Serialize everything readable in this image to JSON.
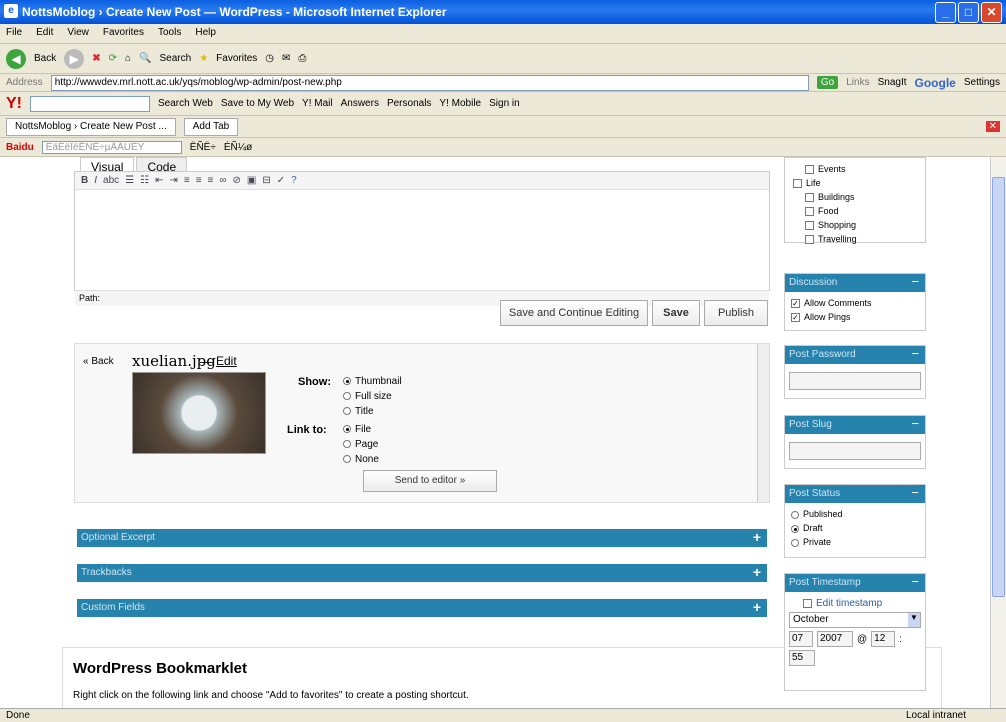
{
  "window": {
    "title": "NottsMoblog › Create New Post — WordPress - Microsoft Internet Explorer"
  },
  "menu": [
    "File",
    "Edit",
    "View",
    "Favorites",
    "Tools",
    "Help"
  ],
  "toolbar": {
    "back": "Back",
    "search": "Search",
    "favorites": "Favorites"
  },
  "address": {
    "label": "Address",
    "url": "http://wwwdev.mrl.nott.ac.uk/yqs/moblog/wp-admin/post-new.php",
    "go": "Go",
    "links": "Links",
    "snagit": "SnagIt",
    "google": "Google",
    "settings": "Settings"
  },
  "yahoo": {
    "search": "Search Web",
    "save": "Save to My Web",
    "mail": "Y! Mail",
    "answers": "Answers",
    "personals": "Personals",
    "mobile": "Y! Mobile",
    "signin": "Sign in"
  },
  "tabs": {
    "current": "NottsMoblog › Create New Post ...",
    "add": "Add Tab"
  },
  "baidu": {
    "brand": "Baidu",
    "garbled": "ÊäÈëÏëËÑË÷µÄÄÚÈÝ",
    "search": "ËÑË÷",
    "misc": "ÉÑ¼ø"
  },
  "editor": {
    "tab_visual": "Visual",
    "tab_code": "Code",
    "path": "Path:"
  },
  "buttons": {
    "save_continue": "Save and Continue Editing",
    "save": "Save",
    "publish": "Publish"
  },
  "media": {
    "back": "« Back",
    "filename": "xuelian.jpg",
    "dash": "—",
    "edit": "Edit",
    "show_label": "Show:",
    "show_options": [
      "Thumbnail",
      "Full size",
      "Title"
    ],
    "link_label": "Link to:",
    "link_options": [
      "File",
      "Page",
      "None"
    ],
    "send": "Send to editor »"
  },
  "panels": {
    "excerpt": "Optional Excerpt",
    "trackbacks": "Trackbacks",
    "custom": "Custom Fields"
  },
  "categories": [
    {
      "label": "Events",
      "indent": 1
    },
    {
      "label": "Life",
      "indent": 0
    },
    {
      "label": "Buildings",
      "indent": 1
    },
    {
      "label": "Food",
      "indent": 1
    },
    {
      "label": "Shopping",
      "indent": 1
    },
    {
      "label": "Travelling",
      "indent": 1
    }
  ],
  "sidebar": {
    "discussion": {
      "title": "Discussion",
      "items": [
        "Allow Comments",
        "Allow Pings"
      ]
    },
    "password": {
      "title": "Post Password"
    },
    "slug": {
      "title": "Post Slug"
    },
    "status": {
      "title": "Post Status",
      "items": [
        "Published",
        "Draft",
        "Private"
      ]
    },
    "timestamp": {
      "title": "Post Timestamp",
      "edit": "Edit timestamp",
      "month": "October",
      "day": "07",
      "year": "2007",
      "at": "@",
      "hour": "12",
      "sep": ":",
      "minute": "55"
    }
  },
  "bookmarklet": {
    "title": "WordPress Bookmarklet",
    "text": "Right click on the following link and choose \"Add to favorites\" to create a posting shortcut."
  },
  "status": {
    "left": "Done",
    "right": "Local intranet"
  }
}
